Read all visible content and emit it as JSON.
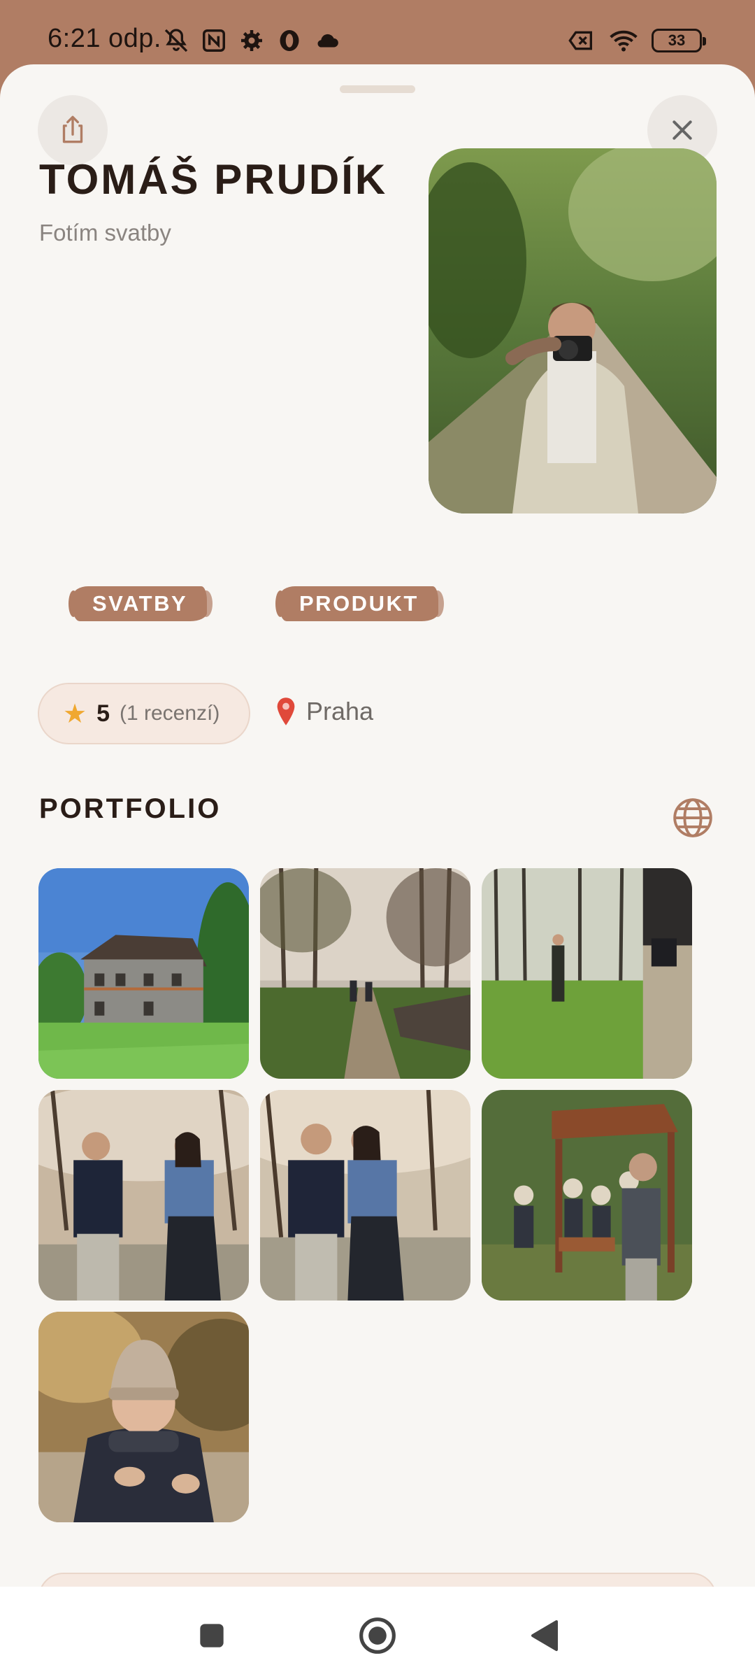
{
  "status_bar": {
    "time": "6:21 odp.",
    "battery_level": "33",
    "icons_left": [
      "notifications-off-icon",
      "nfc-icon",
      "settings-icon",
      "opera-icon",
      "cloud-icon"
    ],
    "icons_right": [
      "no-sim-icon",
      "wifi-icon",
      "battery-icon"
    ]
  },
  "profile": {
    "name": "TOMÁŠ PRUDÍK",
    "subtitle": "Fotím svatby",
    "tags": [
      "SVATBY",
      "PRODUKT"
    ],
    "rating_value": "5",
    "rating_count": "(1 recenzí)",
    "location": "Praha"
  },
  "portfolio": {
    "title": "PORTFOLIO",
    "photos": [
      "photo-stone-house",
      "photo-forest-path",
      "photo-pregnant-woman-park",
      "photo-couple-holding-hands",
      "photo-couple-kissing",
      "photo-playground-kids",
      "photo-child-beanie"
    ]
  },
  "colors": {
    "accent": "#b07d64",
    "background": "#f8f6f3",
    "text_dark": "#2a1d17",
    "pill_bg": "#f6e9e1",
    "star": "#f0a830"
  }
}
